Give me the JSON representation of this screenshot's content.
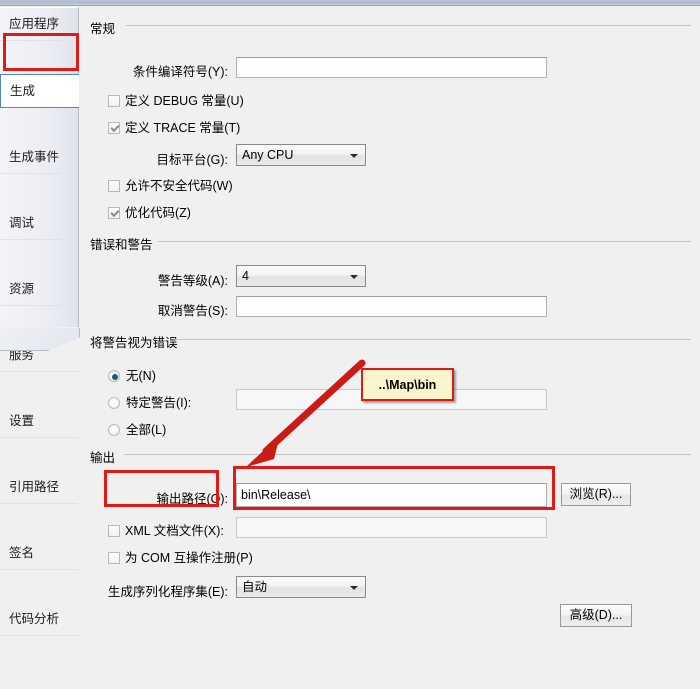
{
  "window": {
    "background_color": "#f0f0f0",
    "accent_selection_color": "#4f87c4",
    "annotation_color": "#e01b16",
    "callout_fill_color": "#fbf5cd"
  },
  "sidebar": {
    "items": [
      {
        "label": "应用程序",
        "selected": false
      },
      {
        "label": "生成",
        "selected": true
      },
      {
        "label": "生成事件",
        "selected": false
      },
      {
        "label": "调试",
        "selected": false
      },
      {
        "label": "资源",
        "selected": false
      },
      {
        "label": "服务",
        "selected": false
      },
      {
        "label": "设置",
        "selected": false
      },
      {
        "label": "引用路径",
        "selected": false
      },
      {
        "label": "签名",
        "selected": false
      },
      {
        "label": "代码分析",
        "selected": false
      }
    ]
  },
  "groups": {
    "general": {
      "title": "常规"
    },
    "errors": {
      "title": "错误和警告"
    },
    "warnings_as_errors": {
      "title": "将警告视为错误"
    },
    "output": {
      "title": "输出"
    }
  },
  "general": {
    "conditional_symbols_label": "条件编译符号(Y):",
    "conditional_symbols_value": "",
    "define_debug_label": "定义 DEBUG 常量(U)",
    "define_debug_checked": false,
    "define_trace_label": "定义 TRACE 常量(T)",
    "define_trace_checked": true,
    "platform_target_label": "目标平台(G):",
    "platform_target_value": "Any CPU",
    "allow_unsafe_label": "允许不安全代码(W)",
    "allow_unsafe_checked": false,
    "optimize_code_label": "优化代码(Z)",
    "optimize_code_checked": true
  },
  "errors": {
    "warning_level_label": "警告等级(A):",
    "warning_level_value": "4",
    "suppress_warnings_label": "取消警告(S):",
    "suppress_warnings_value": ""
  },
  "warnings_as_errors": {
    "none_label": "无(N)",
    "none_selected": true,
    "specific_label": "特定警告(I):",
    "specific_selected": false,
    "specific_value": "",
    "all_label": "全部(L)",
    "all_selected": false
  },
  "output": {
    "output_path_label": "输出路径(O):",
    "output_path_value": "bin\\Release\\",
    "browse_button_label": "浏览(R)...",
    "xml_doc_label": "XML 文档文件(X):",
    "xml_doc_checked": false,
    "xml_doc_value": "",
    "com_interop_label": "为 COM 互操作注册(P)",
    "com_interop_checked": false,
    "serialization_label": "生成序列化程序集(E):",
    "serialization_value": "自动",
    "advanced_button_label": "高级(D)..."
  },
  "annotations": {
    "callout_text": "..\\Map\\bin",
    "highlight_names": [
      "sidebar-build-tab",
      "output-path-label",
      "output-path-textbox"
    ]
  }
}
